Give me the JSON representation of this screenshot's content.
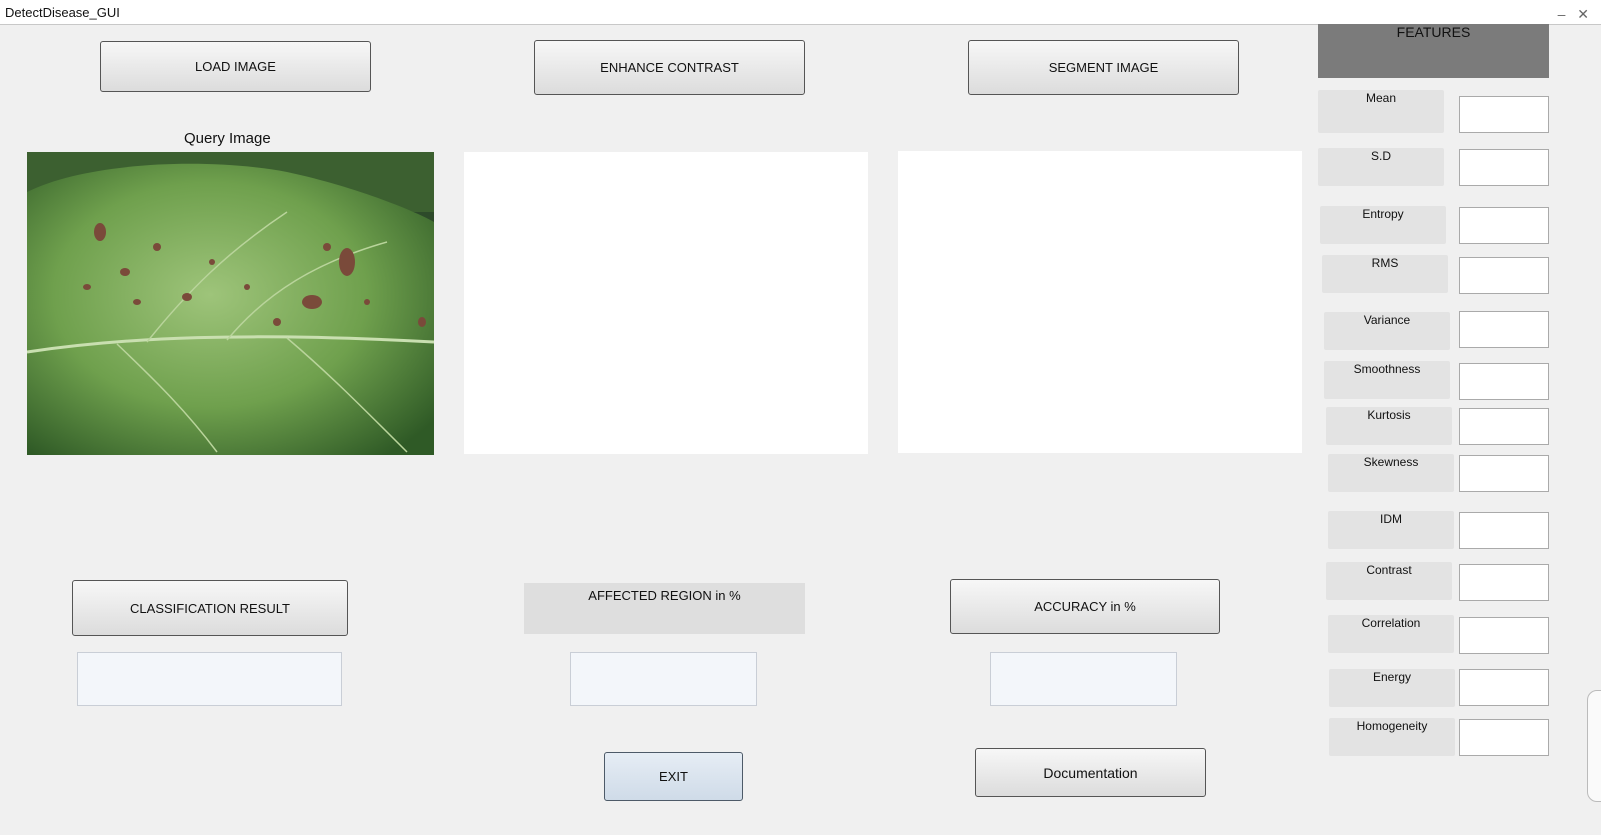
{
  "window": {
    "title": "DetectDisease_GUI",
    "controls": "– ✕"
  },
  "buttons": {
    "load": "LOAD IMAGE",
    "enhance": "ENHANCE CONTRAST",
    "segment": "SEGMENT IMAGE",
    "classify": "CLASSIFICATION RESULT",
    "accuracy": "ACCURACY in %",
    "exit": "EXIT",
    "docs": "Documentation"
  },
  "labels": {
    "query_image": "Query Image",
    "affected_region": "AFFECTED REGION in %"
  },
  "features": {
    "title": "FEATURES",
    "items": [
      "Mean",
      "S.D",
      "Entropy",
      "RMS",
      "Variance",
      "Smoothness",
      "Kurtosis",
      "Skewness",
      "IDM",
      "Contrast",
      "Correlation",
      "Energy",
      "Homogeneity"
    ]
  },
  "colors": {
    "background": "#f0f0f0",
    "features_header": "#7b7b7b",
    "exit_button": "#cfdbe8"
  },
  "icons": {
    "close": "close-icon",
    "minimize": "minimize-icon"
  }
}
